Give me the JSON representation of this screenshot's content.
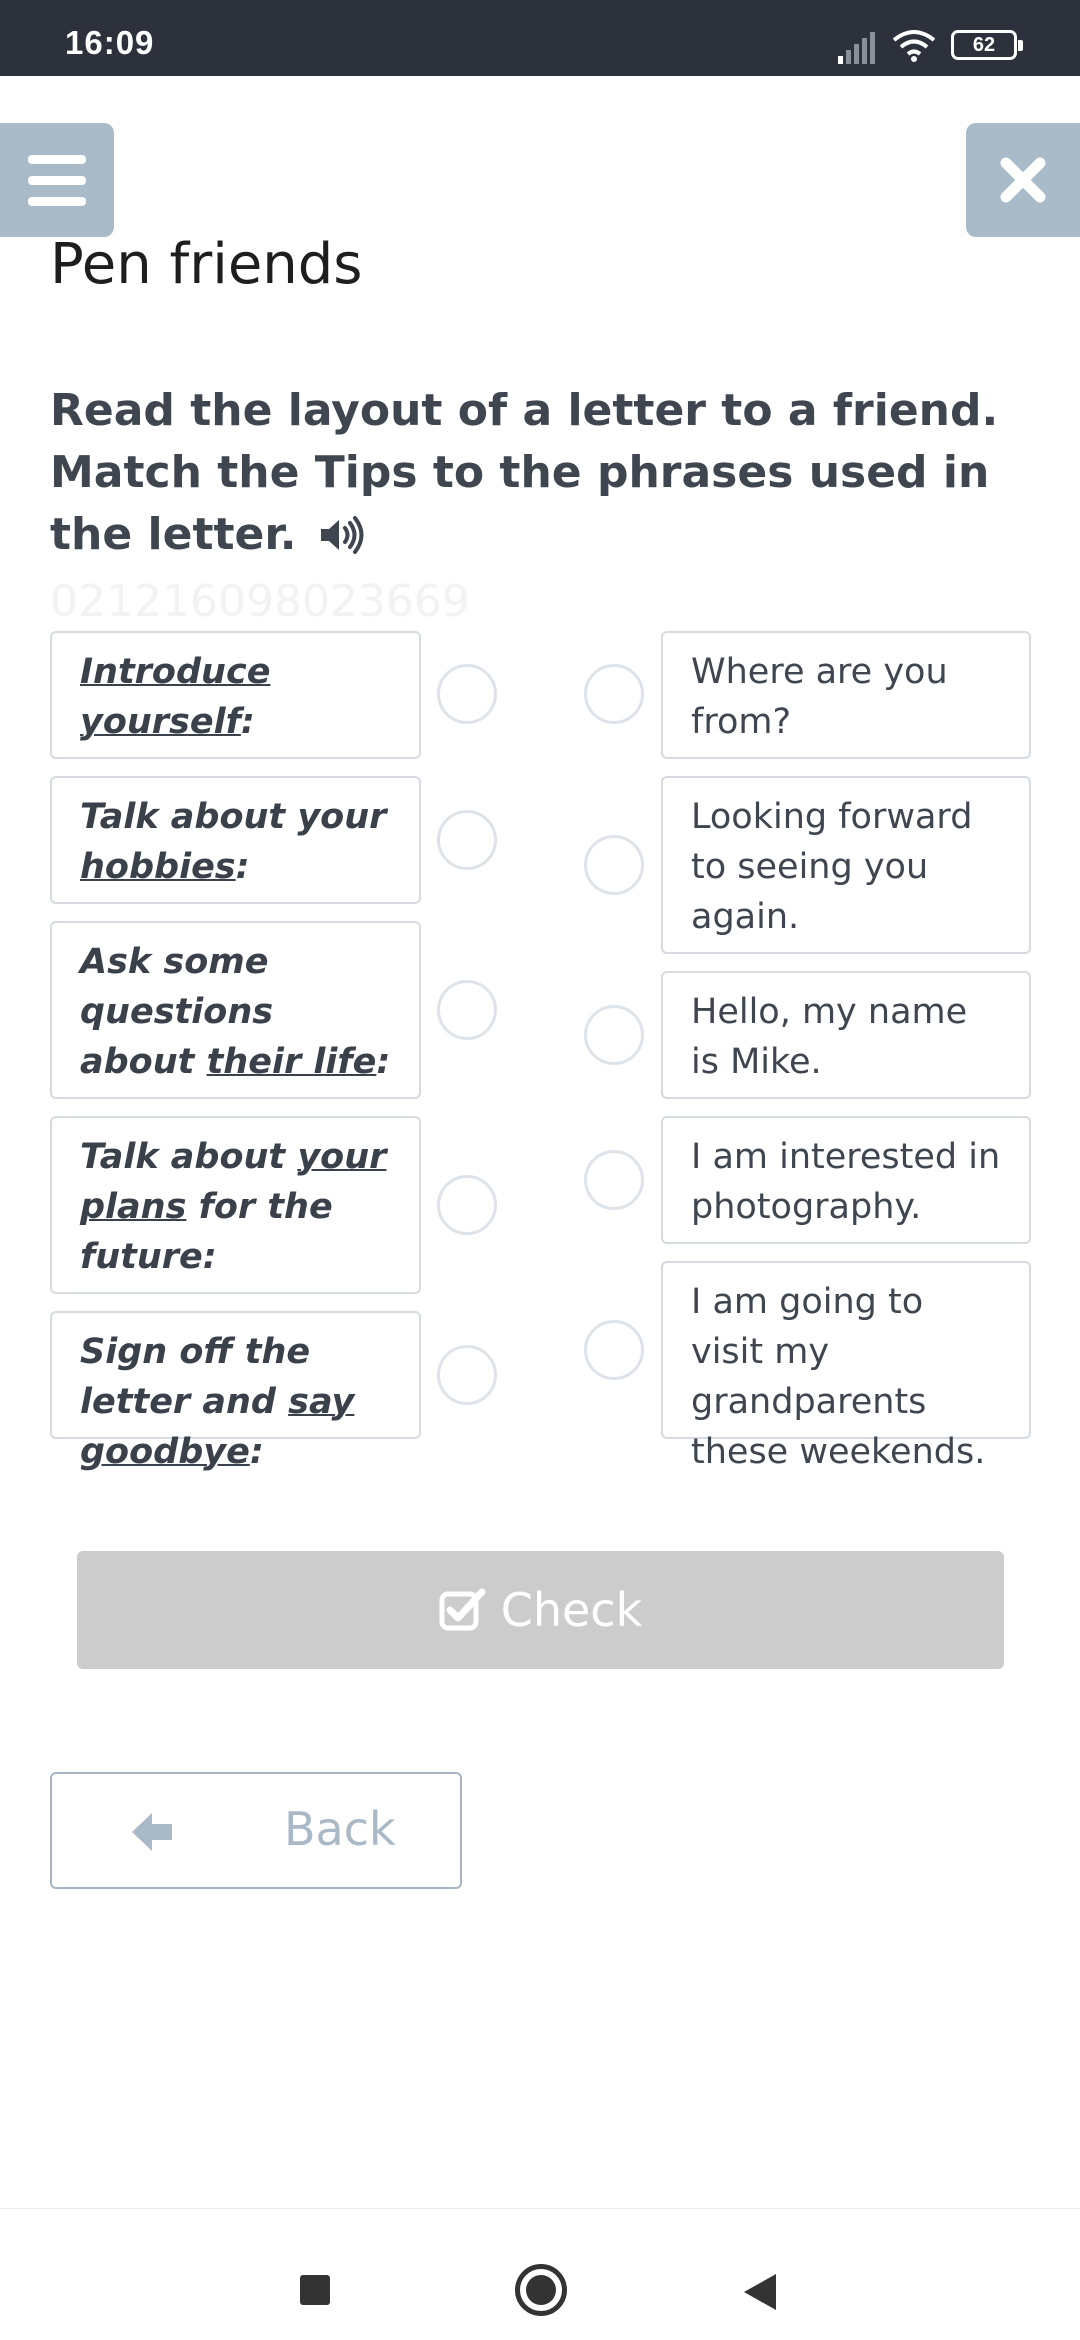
{
  "status_bar": {
    "time": "16:09",
    "battery": "62"
  },
  "header": {
    "title": "Pen friends"
  },
  "instruction": {
    "text": "Read the layout of a letter to a friend. Match the Tips to the phrases used in the letter.",
    "faint_id": "021216098023669"
  },
  "tips": [
    {
      "plain": "",
      "underlined": "Introduce yourself",
      "suffix": ":"
    },
    {
      "plain": "Talk about your ",
      "underlined": "hobbies",
      "suffix": ":"
    },
    {
      "plain": "Ask some questions about ",
      "underlined": "their life",
      "suffix": ":"
    },
    {
      "plain": "Talk about ",
      "underlined": "your plans",
      "suffix": " for the future:"
    },
    {
      "plain": "Sign off the letter and ",
      "underlined": "say goodbye",
      "suffix": ":"
    }
  ],
  "phrases": [
    "Where are you from?",
    "Looking forward to seeing you again.",
    "Hello, my name is Mike.",
    "I am interested in photography.",
    "I am going to visit my grandparents these weekends."
  ],
  "buttons": {
    "check": "Check",
    "back": "Back"
  },
  "colors": {
    "accent": "#a9bac8",
    "check_disabled": "#cccccc",
    "status_bar": "#2c313c"
  }
}
